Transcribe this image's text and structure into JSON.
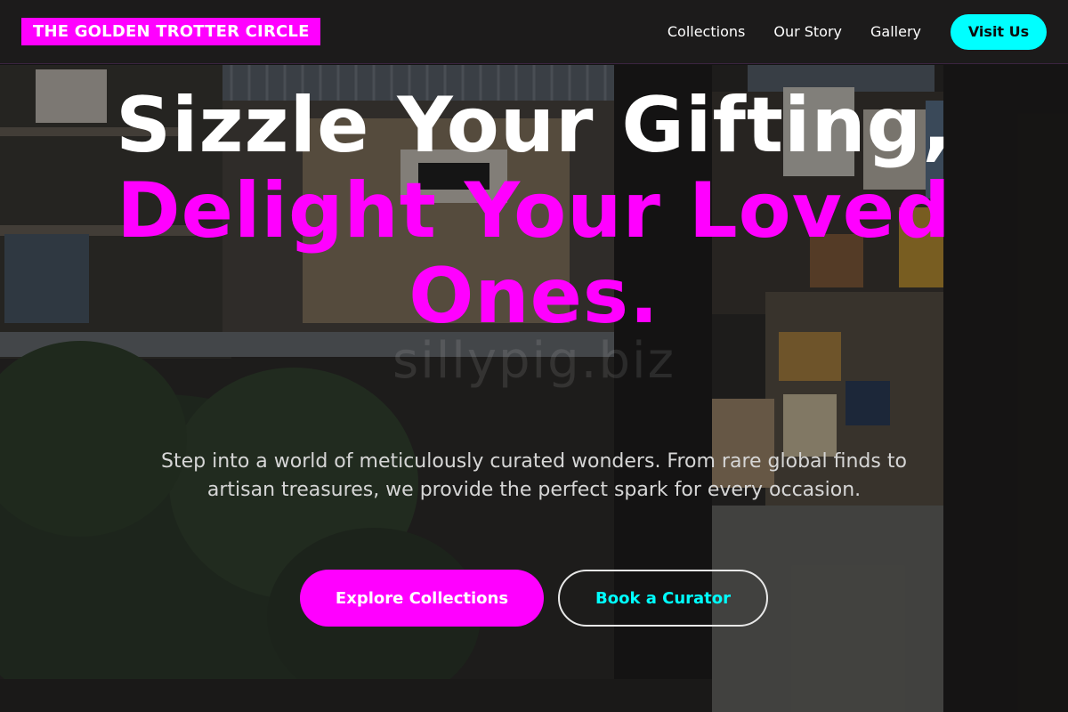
{
  "header": {
    "brand": "THE GOLDEN TROTTER CIRCLE",
    "nav": [
      {
        "label": "Collections"
      },
      {
        "label": "Our Story"
      },
      {
        "label": "Gallery"
      }
    ],
    "cta": "Visit Us"
  },
  "hero": {
    "headline_white": "Sizzle Your Gifting, ",
    "headline_accent": "Delight Your Loved Ones.",
    "subtext": "Step into a world of meticulously curated wonders. From rare global finds to artisan treasures, we provide the perfect spark for every occasion.",
    "primary_button": "Explore Collections",
    "secondary_button": "Book a Curator",
    "watermark": "sillypig.biz"
  },
  "colors": {
    "accent_magenta": "#ff00ff",
    "accent_cyan": "#00ffff",
    "nav_background": "#1c1b1b"
  }
}
